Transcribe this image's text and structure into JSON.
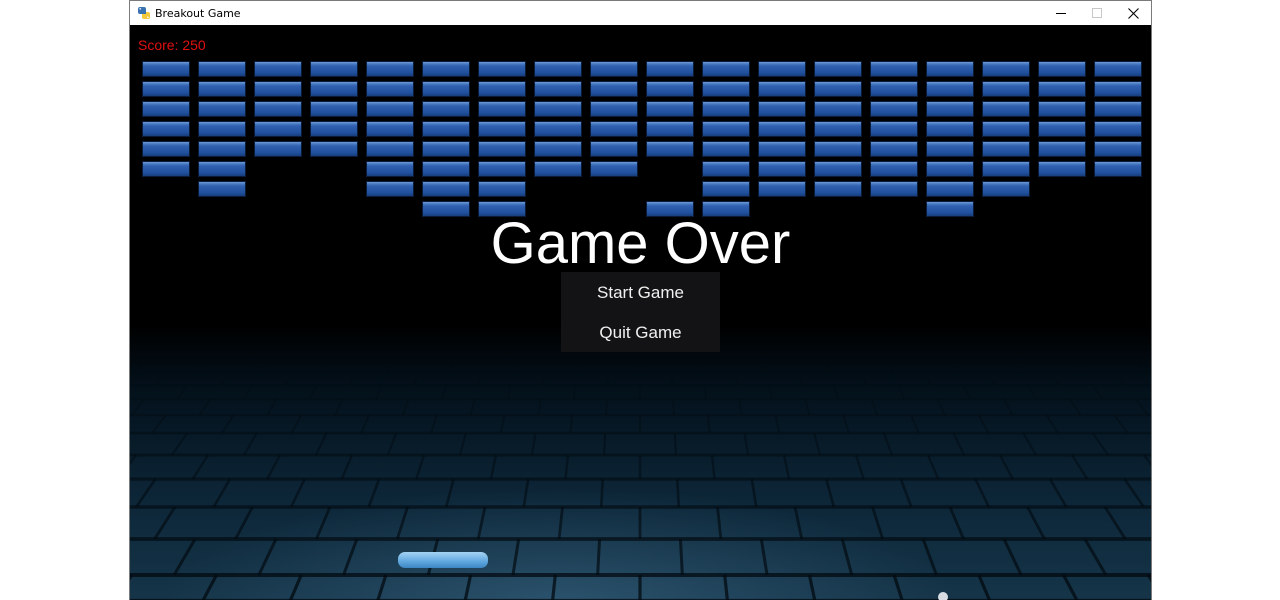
{
  "window": {
    "title": "Breakout Game",
    "controls": {
      "minimize": "minimize-icon",
      "maximize": "maximize-icon",
      "close": "close-icon"
    }
  },
  "game": {
    "score_text": "Score: 250",
    "score": 250,
    "game_over_text": "Game Over",
    "menu": {
      "start_label": "Start Game",
      "quit_label": "Quit Game"
    },
    "bricks": {
      "columns": 18,
      "rows": 8,
      "remaining_per_row": [
        "111111111111111111",
        "111111111111111111",
        "111111111111111111",
        "111111111111111111",
        "111111111111111111",
        "110011111011111111",
        "010011100011111100",
        "000001100110001000"
      ],
      "color": "#1f4f9c"
    },
    "colors": {
      "score": "#e01010",
      "text": "#ffffff",
      "menu_background": "#131214",
      "paddle": "#5ea7de",
      "ball": "#d8dde4"
    }
  }
}
